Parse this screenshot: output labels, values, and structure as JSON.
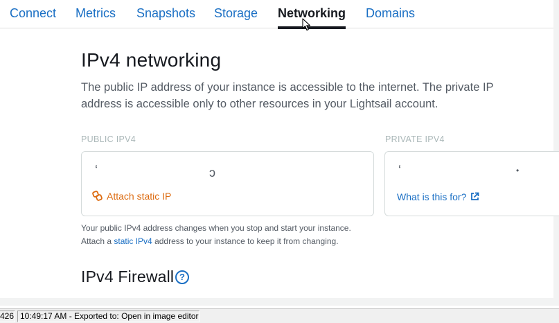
{
  "tabs": [
    {
      "label": "Connect"
    },
    {
      "label": "Metrics"
    },
    {
      "label": "Snapshots"
    },
    {
      "label": "Storage"
    },
    {
      "label": "Networking"
    },
    {
      "label": "Domains"
    }
  ],
  "active_tab": "Networking",
  "ipv4": {
    "title": "IPv4 networking",
    "description": "The public IP address of your instance is accessible to the internet. The private IP address is accessible only to other resources in your Lightsail account.",
    "public_label": "PUBLIC IPV4",
    "private_label": "PRIVATE IPV4",
    "attach_static_ip": "Attach static IP",
    "what_is_this_for": "What is this for?",
    "help_line1": "Your public IPv4 address changes when you stop and start your instance.",
    "help_line2_before": "Attach a ",
    "help_link": "static IPv4",
    "help_line2_after": " address to your instance to keep it from changing."
  },
  "firewall": {
    "title": "IPv4 Firewall",
    "info_glyph": "?"
  },
  "statusbar": {
    "left_value": "426",
    "message": "10:49:17 AM - Exported to: Open in image editor"
  },
  "colors": {
    "link": "#1a6fc4",
    "accent_orange": "#dd6b10",
    "text_dark": "#16191f",
    "text_muted": "#545b64"
  },
  "icons": {
    "attach": "chain-link-icon",
    "external": "external-link-icon",
    "info": "help-circle-icon",
    "cursor": "mouse-cursor-icon"
  }
}
